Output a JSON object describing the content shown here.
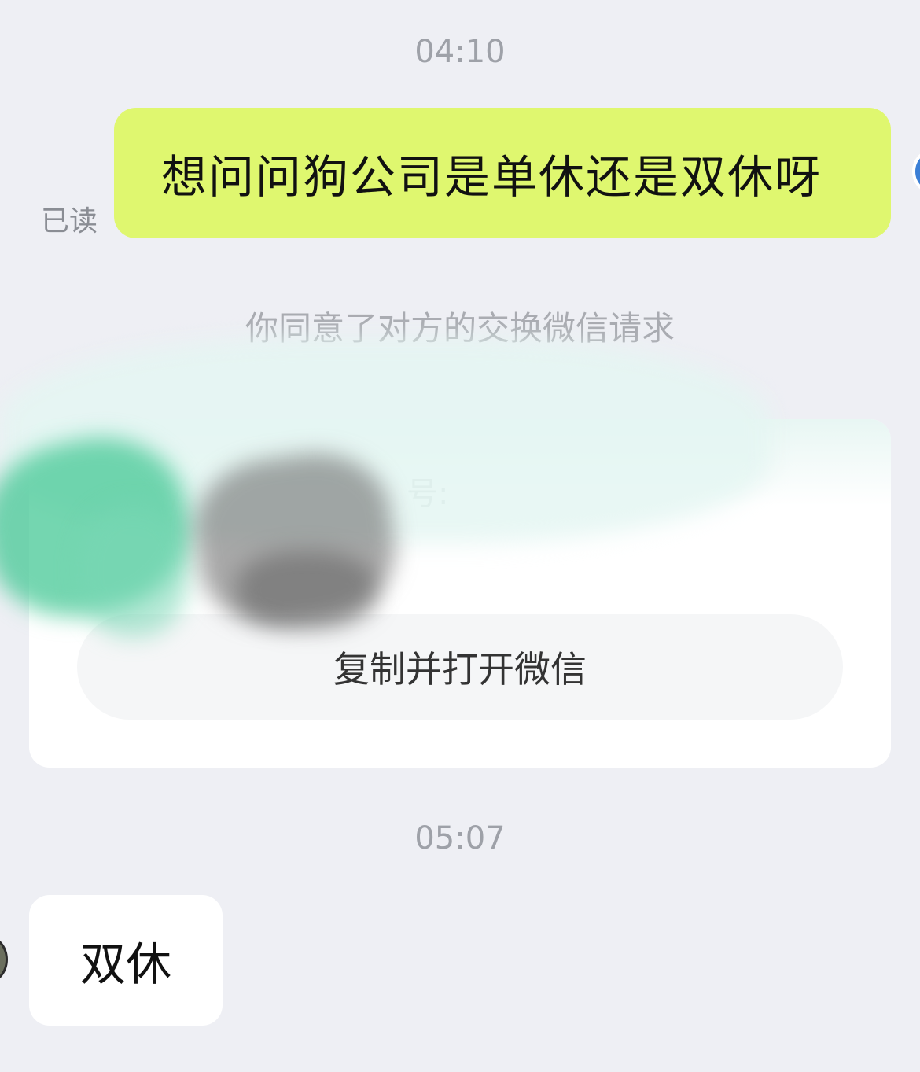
{
  "chat": {
    "timestamps": [
      "04:10",
      "05:07"
    ],
    "sent_message": {
      "text": "想问问狗公司是单休还是双休呀",
      "status": "已读",
      "bubble_color": "#dff76f"
    },
    "system_note": "你同意了对方的交换微信请求",
    "wechat_card": {
      "id_label": "号:",
      "copy_button_label": "复制并打开微信",
      "redacted": true
    },
    "received_message": {
      "text": "双休"
    }
  },
  "colors": {
    "background": "#eeeff4",
    "sent_bubble": "#dff76f",
    "received_bubble": "#ffffff",
    "timestamp_text": "#9ea1a8"
  }
}
